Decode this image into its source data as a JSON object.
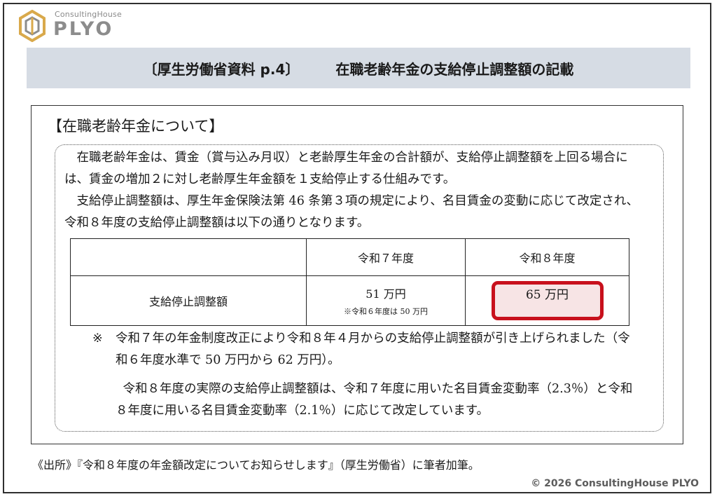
{
  "brand": {
    "tagline": "ConsultingHouse",
    "name": "PLYO",
    "logo_color": "#d9a94b"
  },
  "title": {
    "source_ref": "〔厚生労働省資料 p.4〕",
    "main": "在職老齢年金の支給停止調整額の記載"
  },
  "box": {
    "heading": "【在職老齢年金について】",
    "paragraph1": "在職老齢年金は、賃金（賞与込み月収）と老齢厚生年金の合計額が、支給停止調整額を上回る場合には、賃金の増加２に対し老齢厚生年金額を１支給停止する仕組みです。",
    "paragraph2": "支給停止調整額は、厚生年金保険法第 46 条第３項の規定により、名目賃金の変動に応じて改定され、令和８年度の支給停止調整額は以下の通りとなります。",
    "table": {
      "headers": [
        "",
        "令和７年度",
        "令和８年度"
      ],
      "row_label": "支給停止調整額",
      "r7_value": "51 万円",
      "r7_note": "※令和６年度は 50 万円",
      "r8_value": "65 万円"
    },
    "note_mark": "※",
    "note_text": "令和７年の年金制度改正により令和８年４月からの支給停止調整額が引き上げられました（令和６年度水準で 50 万円から 62 万円）。",
    "paragraph3": "令和８年度の実際の支給停止調整額は、令和７年度に用いた名目賃金変動率（2.3％）と令和８年度に用いる名目賃金変動率（2.1％）に応じて改定しています。"
  },
  "source": "《出所》『令和８年度の年金額改定についてお知らせします』（厚生労働省）に筆者加筆。",
  "copyright": "© 2026 ConsultingHouse PLYO",
  "colors": {
    "title_band": "#d6dce4",
    "highlight_border": "#c8101c",
    "highlight_fill": "#f7e4e5"
  }
}
